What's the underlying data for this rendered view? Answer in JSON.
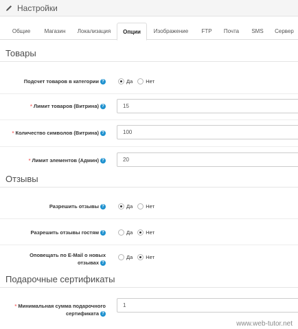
{
  "header": {
    "title": "Настройки",
    "icon": "pencil-icon"
  },
  "tabs": [
    {
      "label": "Общие"
    },
    {
      "label": "Магазин"
    },
    {
      "label": "Локализация"
    },
    {
      "label": "Опции",
      "active": true
    },
    {
      "label": "Изображение"
    },
    {
      "label": "FTP"
    },
    {
      "label": "Почта"
    },
    {
      "label": "SMS"
    },
    {
      "label": "Сервер"
    }
  ],
  "sections": {
    "products": {
      "title": "Товары",
      "count_in_category": {
        "label": "Подсчет товаров в категории",
        "yes": "Да",
        "no": "Нет",
        "selected": "yes"
      },
      "product_limit": {
        "label": "Лимит товаров (Витрина)",
        "value": "15",
        "required": true
      },
      "description_length": {
        "label": "Количество символов (Витрина)",
        "value": "100",
        "required": true
      },
      "admin_limit": {
        "label": "Лимит элементов (Админ)",
        "value": "20",
        "required": true
      }
    },
    "reviews": {
      "title": "Отзывы",
      "allow_reviews": {
        "label": "Разрешить отзывы",
        "yes": "Да",
        "no": "Нет",
        "selected": "yes"
      },
      "allow_guest_reviews": {
        "label": "Разрешить отзывы гостям",
        "yes": "Да",
        "no": "Нет",
        "selected": "no"
      },
      "notify_email": {
        "label_line1": "Оповещать по E-Mail о новых",
        "label_line2": "отзывах",
        "yes": "Да",
        "no": "Нет",
        "selected": "no"
      }
    },
    "vouchers": {
      "title": "Подарочные сертификаты",
      "voucher_min": {
        "label_line1": "Минимальная сумма подарочного",
        "label_line2": "сертификата",
        "value": "1",
        "required": true
      }
    }
  },
  "help_glyph": "?",
  "required_glyph": "*",
  "watermark": "www.web-tutor.net",
  "colors": {
    "help": "#1e91cf",
    "required": "#f56b6b",
    "border": "#cccccc"
  }
}
